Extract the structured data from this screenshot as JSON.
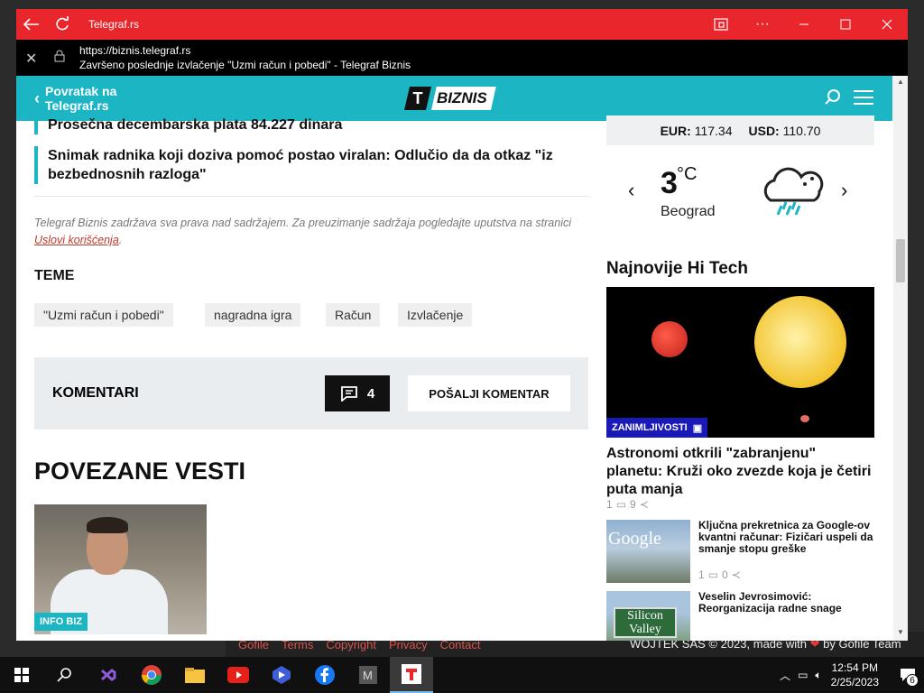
{
  "window": {
    "title": "Telegraf.rs",
    "url": "https://biznis.telegraf.rs",
    "page_title": "Završeno poslednje izvlačenje \"Uzmi račun i pobedi\" - Telegraf Biznis"
  },
  "header": {
    "back_label_1": "Povratak na",
    "back_label_2": "Telegraf.rs",
    "logo_letter": "T",
    "logo_word": "BIZNIS"
  },
  "headlines": [
    "Prosečna decembarska plata 84.227 dinara",
    "Snimak radnika koji doziva pomoć postao viralan: Odlučio da da otkaz \"iz bezbednosnih razloga\""
  ],
  "rights": {
    "text": "Telegraf Biznis zadržava sva prava nad sadržajem. Za preuzimanje sadržaja pogledajte uputstva na stranici ",
    "link": "Uslovi korišćenja",
    "end": "."
  },
  "teme": {
    "label": "TEME",
    "tags": [
      "\"Uzmi račun i pobedi\"",
      "nagradna igra",
      "Račun",
      "Izvlačenje"
    ]
  },
  "comments": {
    "label": "KOMENTARI",
    "count": "4",
    "send": "POŠALJI KOMENTAR"
  },
  "related": {
    "title": "POVEZANE VESTI",
    "badge": "INFO BIZ"
  },
  "currency": {
    "eur_label": "EUR:",
    "eur": "117.34",
    "usd_label": "USD:",
    "usd": "110.70"
  },
  "weather": {
    "temp": "3",
    "unit": "°C",
    "city": "Beograd"
  },
  "hitech": {
    "title": "Najnovije Hi Tech",
    "featured": {
      "badge": "ZANIMLJIVOSTI",
      "title": "Astronomi otkrili \"zabranjenu\" planetu: Kruži oko zvezde koja je četiri puta manja",
      "comments": "1",
      "shares": "9"
    },
    "items": [
      {
        "title": "Ključna prekretnica za Google-ov kvantni računar: Fizičari uspeli da smanje stopu greške",
        "comments": "1",
        "shares": "0",
        "thumb_text": "Google"
      },
      {
        "title": "Veselin Jevrosimović: Reorganizacija radne snage",
        "thumb_text": "Silicon Valley"
      }
    ]
  },
  "bg_footer": {
    "links": [
      "Gofile",
      "Terms",
      "Copyright",
      "Privacy",
      "Contact"
    ],
    "credit_1": "WOJTEK SAS © 2023, made with ",
    "credit_2": " by Gofile Team"
  },
  "tray": {
    "time": "12:54 PM",
    "date": "2/25/2023",
    "notifications": "6"
  }
}
